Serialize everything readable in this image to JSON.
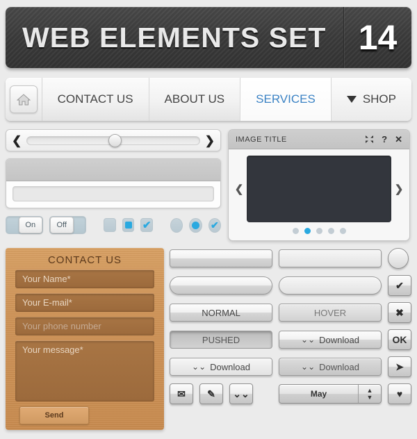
{
  "header": {
    "title": "WEB ELEMENTS SET",
    "number": "14"
  },
  "nav": {
    "home_icon": "home-icon",
    "items": [
      {
        "label": "CONTACT US",
        "active": false
      },
      {
        "label": "ABOUT US",
        "active": false
      },
      {
        "label": "SERVICES",
        "active": true
      },
      {
        "label": "SHOP",
        "active": false,
        "has_caret": true
      }
    ],
    "active_color": "#3a82c4"
  },
  "slider": {
    "prev_icon": "chevron-left-icon",
    "next_icon": "chevron-right-icon",
    "value_percent": 47
  },
  "panel": {
    "header_text": "",
    "input_value": "",
    "input_placeholder": ""
  },
  "toggles": [
    {
      "label": "On",
      "state": "on"
    },
    {
      "label": "Off",
      "state": "off"
    }
  ],
  "checkboxes": [
    {
      "state": "empty"
    },
    {
      "state": "square"
    },
    {
      "state": "check"
    }
  ],
  "radios": [
    {
      "state": "empty"
    },
    {
      "state": "dot"
    },
    {
      "state": "check"
    }
  ],
  "image_widget": {
    "title": "IMAGE TITLE",
    "icons": [
      {
        "name": "expand-icon",
        "glyph": "⤧"
      },
      {
        "name": "help-icon",
        "glyph": "?"
      },
      {
        "name": "close-icon",
        "glyph": "✕"
      }
    ],
    "prev_icon": "chevron-left-icon",
    "next_icon": "chevron-right-icon",
    "dots_total": 5,
    "dots_active_index": 1
  },
  "contact_form": {
    "title": "CONTACT US",
    "fields": [
      {
        "placeholder": "Your Name*",
        "dim": false
      },
      {
        "placeholder": "Your E-mail*",
        "dim": false
      },
      {
        "placeholder": "Your phone number",
        "dim": true
      }
    ],
    "message_placeholder": "Your message*",
    "submit_label": "Send"
  },
  "buttons": {
    "row1": [
      {
        "label": "",
        "style": "normal",
        "name": "blank-button-1"
      },
      {
        "label": "",
        "style": "flat",
        "name": "blank-button-2"
      }
    ],
    "row2": [
      {
        "label": "",
        "style": "round-normal",
        "name": "blank-round-button-1"
      },
      {
        "label": "",
        "style": "round-flat",
        "name": "blank-round-button-2"
      }
    ],
    "row3": [
      {
        "label": "NORMAL",
        "style": "normal",
        "name": "normal-button"
      },
      {
        "label": "HOVER",
        "style": "hover",
        "name": "hover-button"
      }
    ],
    "row4": [
      {
        "label": "PUSHED",
        "style": "pushed",
        "name": "pushed-button"
      },
      {
        "label": "Download",
        "style": "normal",
        "icon": "double-chevron-down-icon",
        "name": "download-button-1"
      }
    ],
    "row5": [
      {
        "label": "Download",
        "style": "flat",
        "icon": "double-chevron-down-icon",
        "name": "download-button-2"
      },
      {
        "label": "Download",
        "style": "dl-alt",
        "icon": "double-chevron-down-icon",
        "name": "download-button-3"
      }
    ],
    "icon_buttons": [
      {
        "name": "mail-icon",
        "glyph": "✉"
      },
      {
        "name": "pencil-icon",
        "glyph": "✎"
      },
      {
        "name": "double-chevron-down-icon",
        "glyph": "»"
      }
    ],
    "side_icons": [
      {
        "name": "circle-button",
        "glyph": ""
      },
      {
        "name": "check-icon",
        "glyph": "✔"
      },
      {
        "name": "close-x-icon",
        "glyph": "✖"
      },
      {
        "name": "ok-button",
        "glyph": "OK"
      },
      {
        "name": "arrow-right-icon",
        "glyph": "➤"
      },
      {
        "name": "heart-icon",
        "glyph": "♥"
      }
    ],
    "spinner": {
      "value": "May",
      "up_icon": "caret-up-icon",
      "down_icon": "caret-down-icon"
    }
  },
  "colors": {
    "accent_blue": "#29a9e0",
    "link_blue": "#3a82c4",
    "wood": "#cf9458",
    "background": "#ebebeb"
  }
}
